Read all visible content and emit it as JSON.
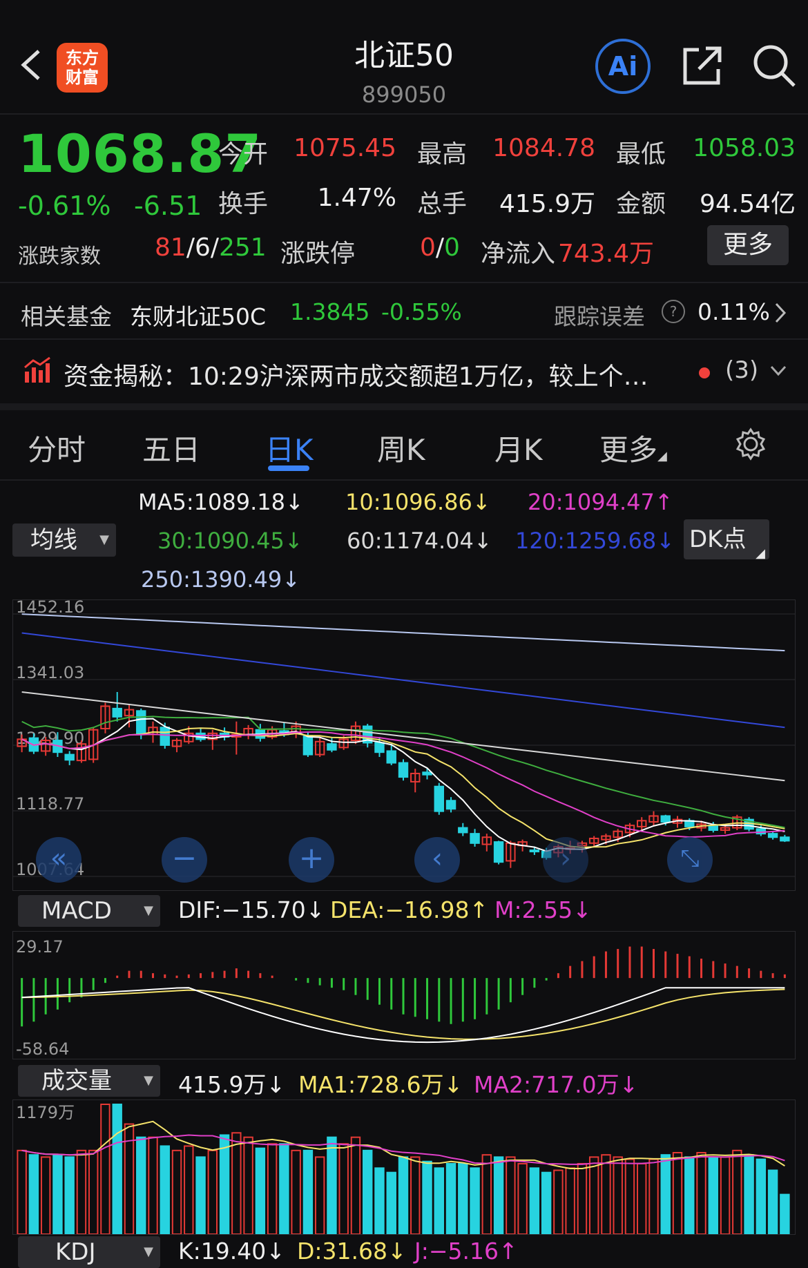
{
  "header": {
    "title": "北证50",
    "code": "899050",
    "logo_text_1": "东方",
    "logo_text_2": "财富",
    "ai_label": "Ai"
  },
  "quote": {
    "price": "1068.87",
    "change_pct": "-0.61%",
    "change": "-6.51",
    "open_label": "今开",
    "open": "1075.45",
    "high_label": "最高",
    "high": "1084.78",
    "low_label": "最低",
    "low": "1058.03",
    "turnover_label": "换手",
    "turnover": "1.47%",
    "volume_label": "总手",
    "volume": "415.9万",
    "amount_label": "金额",
    "amount": "94.54亿",
    "breadth_label": "涨跌家数",
    "breadth_up": "81",
    "breadth_flat": "6",
    "breadth_down": "251",
    "slash": "/",
    "limit_label": "涨跌停",
    "limit_up": "0",
    "limit_down": "0",
    "netflow_label": "净流入",
    "netflow": "743.4万",
    "more_button": "更多"
  },
  "fund": {
    "label": "相关基金",
    "name": "东财北证50C",
    "nav": "1.3845",
    "change": "-0.55%",
    "tracking_label": "跟踪误差",
    "tracking": "0.11%"
  },
  "news": {
    "text": "资金揭秘：10:29沪深两市成交额超1万亿，较上个…",
    "count": "(3)"
  },
  "tabs": [
    "分时",
    "五日",
    "日K",
    "周K",
    "月K",
    "更多"
  ],
  "active_tab": 2,
  "ma_selector": "均线",
  "dk_button": "DK点",
  "ma_legend": {
    "ma5": "MA5:1089.18↓",
    "ma10": "10:1096.86↓",
    "ma20": "20:1094.47↑",
    "ma30": "30:1090.45↓",
    "ma60": "60:1174.04↓",
    "ma120": "120:1259.68↓",
    "ma250": "250:1390.49↓"
  },
  "macd": {
    "selector": "MACD",
    "dif": "DIF:−15.70↓",
    "dea": "DEA:−16.98↑",
    "m": "M:2.55↓"
  },
  "volume_panel": {
    "selector": "成交量",
    "value": "415.9万↓",
    "ma1": "MA1:728.6万↓",
    "ma2": "MA2:717.0万↓"
  },
  "kdj": {
    "selector": "KDJ",
    "k": "K:19.40↓",
    "d": "D:31.68↓",
    "j": "J:−5.16↑"
  },
  "colors": {
    "up": "#f0413c",
    "down": "#2fc83b",
    "candle_up": "#e53935",
    "candle_down": "#27d3e0",
    "ma5": "#ffffff",
    "ma10": "#f5e36b",
    "ma20": "#e040c8",
    "ma30": "#3fae3f",
    "ma60": "#d8d8d8",
    "ma120": "#3348d8",
    "ma250": "#b8c8f0",
    "accent": "#3b82f6"
  },
  "chart_data": [
    {
      "type": "candlestick",
      "title": "日K",
      "y_tick_labels": [
        "1452.16",
        "1341.03",
        "1229.90",
        "1118.77",
        "1007.64"
      ],
      "ylim": [
        1007.64,
        1452.16
      ],
      "candles": [
        [
          1228,
          1248,
          1218,
          1240
        ],
        [
          1242,
          1250,
          1215,
          1220
        ],
        [
          1220,
          1244,
          1212,
          1238
        ],
        [
          1238,
          1252,
          1210,
          1218
        ],
        [
          1214,
          1220,
          1196,
          1205
        ],
        [
          1204,
          1238,
          1200,
          1232
        ],
        [
          1206,
          1260,
          1200,
          1256
        ],
        [
          1258,
          1302,
          1250,
          1296
        ],
        [
          1292,
          1320,
          1270,
          1278
        ],
        [
          1280,
          1300,
          1260,
          1290
        ],
        [
          1288,
          1292,
          1240,
          1250
        ],
        [
          1248,
          1270,
          1234,
          1260
        ],
        [
          1260,
          1268,
          1224,
          1230
        ],
        [
          1228,
          1242,
          1218,
          1238
        ],
        [
          1236,
          1262,
          1232,
          1250
        ],
        [
          1250,
          1258,
          1236,
          1240
        ],
        [
          1240,
          1256,
          1222,
          1250
        ],
        [
          1250,
          1260,
          1238,
          1244
        ],
        [
          1244,
          1270,
          1214,
          1248
        ],
        [
          1248,
          1264,
          1240,
          1258
        ],
        [
          1256,
          1266,
          1236,
          1242
        ],
        [
          1244,
          1262,
          1240,
          1256
        ],
        [
          1254,
          1268,
          1244,
          1248
        ],
        [
          1250,
          1270,
          1242,
          1262
        ],
        [
          1246,
          1252,
          1210,
          1214
        ],
        [
          1214,
          1242,
          1210,
          1236
        ],
        [
          1232,
          1242,
          1218,
          1222
        ],
        [
          1226,
          1246,
          1222,
          1240
        ],
        [
          1238,
          1270,
          1232,
          1262
        ],
        [
          1262,
          1266,
          1226,
          1234
        ],
        [
          1234,
          1244,
          1210,
          1218
        ],
        [
          1220,
          1232,
          1196,
          1200
        ],
        [
          1200,
          1206,
          1170,
          1176
        ],
        [
          1168,
          1190,
          1150,
          1182
        ],
        [
          1184,
          1192,
          1172,
          1180
        ],
        [
          1160,
          1166,
          1112,
          1118
        ],
        [
          1136,
          1142,
          1116,
          1122
        ],
        [
          1090,
          1098,
          1076,
          1082
        ],
        [
          1080,
          1088,
          1058,
          1064
        ],
        [
          1062,
          1080,
          1050,
          1074
        ],
        [
          1066,
          1068,
          1028,
          1032
        ],
        [
          1034,
          1068,
          1022,
          1064
        ],
        [
          1060,
          1070,
          1050,
          1066
        ],
        [
          1052,
          1058,
          1044,
          1050
        ],
        [
          1050,
          1056,
          1036,
          1040
        ],
        [
          1048,
          1062,
          1040,
          1058
        ],
        [
          1054,
          1068,
          1046,
          1056
        ],
        [
          1060,
          1068,
          1048,
          1064
        ],
        [
          1064,
          1076,
          1058,
          1072
        ],
        [
          1070,
          1080,
          1062,
          1076
        ],
        [
          1074,
          1088,
          1066,
          1084
        ],
        [
          1082,
          1098,
          1074,
          1094
        ],
        [
          1092,
          1108,
          1086,
          1102
        ],
        [
          1100,
          1118,
          1094,
          1110
        ],
        [
          1110,
          1112,
          1094,
          1100
        ],
        [
          1098,
          1110,
          1090,
          1104
        ],
        [
          1102,
          1106,
          1086,
          1092
        ],
        [
          1090,
          1102,
          1084,
          1096
        ],
        [
          1094,
          1100,
          1082,
          1086
        ],
        [
          1086,
          1096,
          1080,
          1090
        ],
        [
          1090,
          1112,
          1086,
          1108
        ],
        [
          1104,
          1108,
          1084,
          1088
        ],
        [
          1088,
          1094,
          1076,
          1080
        ],
        [
          1080,
          1084,
          1070,
          1074
        ],
        [
          1074,
          1078,
          1066,
          1068
        ]
      ]
    },
    {
      "type": "bar",
      "title": "MACD",
      "y_tick_labels": [
        "29.17",
        "-58.64"
      ],
      "ylim": [
        -58.64,
        29.17
      ],
      "values": [
        -40,
        -36,
        -30,
        -26,
        -20,
        -16,
        -10,
        -4,
        2,
        6,
        6,
        4,
        3,
        2,
        3,
        4,
        5,
        6,
        8,
        6,
        4,
        2,
        0,
        -2,
        -4,
        -6,
        -8,
        -10,
        -14,
        -18,
        -22,
        -26,
        -30,
        -32,
        -34,
        -36,
        -38,
        -36,
        -34,
        -30,
        -26,
        -20,
        -14,
        -8,
        -2,
        4,
        10,
        14,
        18,
        22,
        24,
        26,
        26,
        24,
        22,
        20,
        18,
        16,
        14,
        12,
        10,
        8,
        6,
        4,
        3
      ]
    },
    {
      "type": "bar",
      "title": "成交量",
      "y_tick_labels": [
        "1179万"
      ],
      "ylim": [
        0,
        1179
      ],
      "values": [
        760,
        720,
        700,
        720,
        700,
        760,
        760,
        1179,
        1179,
        1000,
        880,
        880,
        800,
        760,
        800,
        700,
        760,
        900,
        920,
        880,
        780,
        820,
        820,
        760,
        760,
        700,
        880,
        820,
        880,
        760,
        600,
        560,
        700,
        700,
        660,
        600,
        640,
        640,
        600,
        720,
        700,
        700,
        640,
        600,
        560,
        580,
        600,
        640,
        700,
        720,
        700,
        680,
        640,
        680,
        720,
        740,
        700,
        740,
        700,
        700,
        760,
        720,
        680,
        580,
        360
      ]
    }
  ]
}
